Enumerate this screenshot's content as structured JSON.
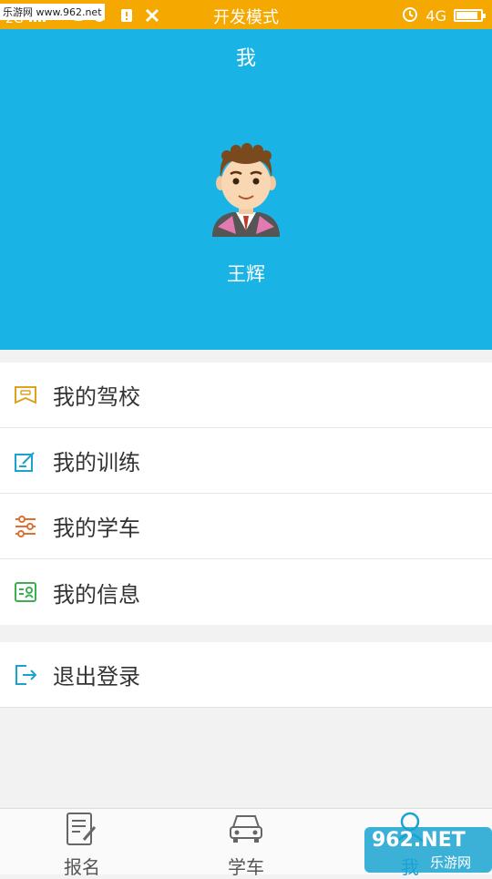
{
  "status_bar": {
    "watermark": "乐游网 www.962.net",
    "network": "2G",
    "mode_label": "开发模式",
    "network_right": "4G",
    "battery_level": 0.9
  },
  "header": {
    "title": "我",
    "username": "王辉"
  },
  "menu": {
    "items": [
      {
        "label": "我的驾校",
        "icon": "driving-school-icon",
        "color": "#e0a020"
      },
      {
        "label": "我的训练",
        "icon": "edit-training-icon",
        "color": "#1aa3d0"
      },
      {
        "label": "我的学车",
        "icon": "sliders-icon",
        "color": "#e07030"
      },
      {
        "label": "我的信息",
        "icon": "id-card-icon",
        "color": "#3cb050"
      }
    ],
    "logout_label": "退出登录",
    "logout_color": "#1aa3d0"
  },
  "tabbar": {
    "tabs": [
      {
        "label": "报名",
        "icon": "signup-icon"
      },
      {
        "label": "学车",
        "icon": "car-icon"
      },
      {
        "label": "我",
        "icon": "user-icon",
        "active": true
      }
    ],
    "active_color": "#1aa3d0"
  },
  "watermark_bottom": {
    "brand": "962.NET",
    "text": "乐游网"
  }
}
